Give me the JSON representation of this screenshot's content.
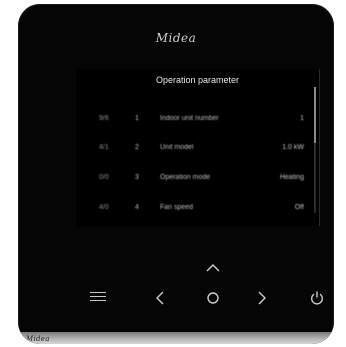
{
  "brand": "Midea",
  "bottom_logo": "Midea",
  "screen": {
    "title": "Operation parameter",
    "rows": [
      {
        "code": "",
        "num": "",
        "name": "",
        "value": ""
      },
      {
        "code": "9/6",
        "num": "1",
        "name": "Indoor unit number",
        "value": "1"
      },
      {
        "code": "4/1",
        "num": "2",
        "name": "Unit model",
        "value": "1.0 kW"
      },
      {
        "code": "0/0",
        "num": "3",
        "name": "Operation mode",
        "value": "Heating"
      },
      {
        "code": "4/0",
        "num": "4",
        "name": "Fan speed",
        "value": "Off"
      }
    ]
  },
  "controls": {
    "menu": "menu-icon",
    "left": "chevron-left-icon",
    "ok": "ok-icon",
    "right": "chevron-right-icon",
    "up": "chevron-up-icon",
    "down": "chevron-down-icon",
    "power": "power-icon"
  }
}
